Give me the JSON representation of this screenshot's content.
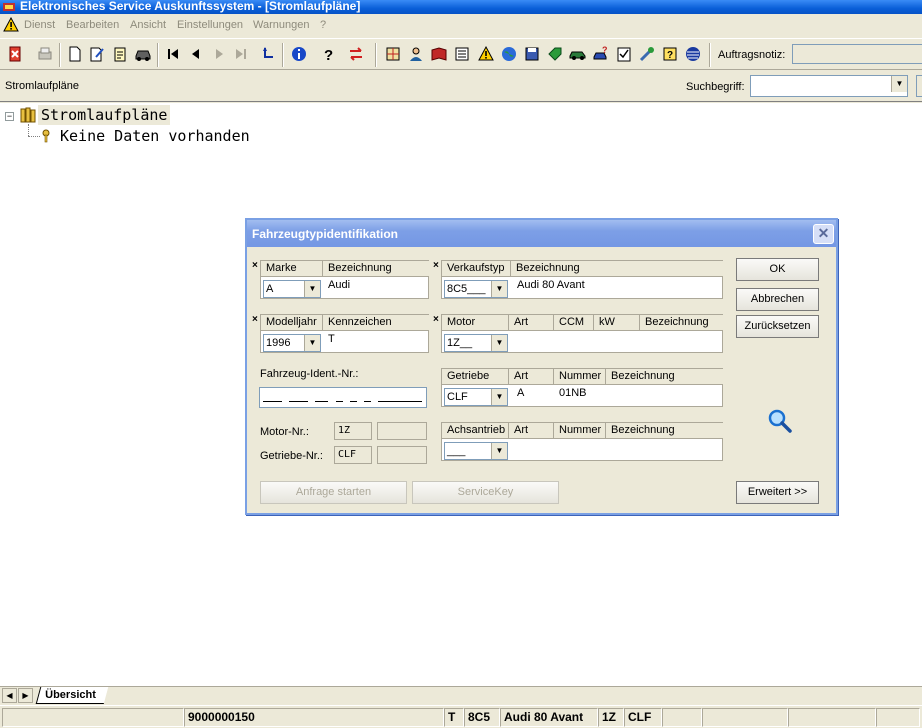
{
  "window": {
    "title": "Elektronisches Service Auskunftssystem - [Stromlaufpläne]"
  },
  "menu": [
    "Dienst",
    "Bearbeiten",
    "Ansicht",
    "Einstellungen",
    "Warnungen",
    "?"
  ],
  "toolbar": {
    "note_label": "Auftragsnotiz:",
    "note_value": "",
    "icons": [
      "exit-icon",
      "print-icon",
      "new-document-icon",
      "edit-document-icon",
      "notes-icon",
      "car-icon",
      "first-icon",
      "previous-icon",
      "next-icon",
      "last-icon",
      "return-icon",
      "info-icon",
      "help-icon",
      "switch-icon",
      "wiring-icon",
      "person-icon",
      "book-icon",
      "list-icon",
      "warning-icon",
      "globe-icon",
      "save-icon",
      "tag-icon",
      "vehicle-icon",
      "service-icon",
      "checklist-icon",
      "tools-icon",
      "question-icon",
      "stack-icon"
    ]
  },
  "bar": {
    "title": "Stromlaufpläne",
    "search_label": "Suchbegriff:",
    "search_value": ""
  },
  "tree": {
    "root_label": "Stromlaufpläne",
    "child_label": "Keine Daten vorhanden"
  },
  "dialog": {
    "title": "Fahrzeugtypidentifikation",
    "required_mark": "×",
    "marke": {
      "headers": [
        "Marke",
        "Bezeichnung"
      ],
      "value": "A",
      "description": "Audi"
    },
    "verkaufstyp": {
      "headers": [
        "Verkaufstyp",
        "Bezeichnung"
      ],
      "value": "8C5___",
      "description": "Audi 80 Avant"
    },
    "modelljahr": {
      "headers": [
        "Modelljahr",
        "Kennzeichen"
      ],
      "value": "1996",
      "description": "T"
    },
    "motor": {
      "headers": [
        "Motor",
        "Art",
        "CCM",
        "kW",
        "Bezeichnung"
      ],
      "value": "1Z__",
      "art": "",
      "ccm": "",
      "kw": "",
      "description": ""
    },
    "fin_label": "Fahrzeug-Ident.-Nr.:",
    "getriebe": {
      "headers": [
        "Getriebe",
        "Art",
        "Nummer",
        "Bezeichnung"
      ],
      "value": "CLF",
      "art": "A",
      "nummer": "01NB",
      "description": ""
    },
    "motor_nr_label": "Motor-Nr.:",
    "motor_nr_value": "1Z",
    "getriebe_nr_label": "Getriebe-Nr.:",
    "getriebe_nr_value": "CLF",
    "achsantrieb": {
      "headers": [
        "Achsantrieb",
        "Art",
        "Nummer",
        "Bezeichnung"
      ],
      "value": "___",
      "art": "",
      "nummer": "",
      "description": ""
    },
    "buttons": {
      "ok": "OK",
      "cancel": "Abbrechen",
      "reset": "Zurücksetzen",
      "extended": "Erweitert >>",
      "request": "Anfrage starten",
      "servicekey": "ServiceKey"
    }
  },
  "tabs": {
    "active": "Übersicht"
  },
  "status": {
    "order_number": "9000000150",
    "kennzeichen": "T",
    "verkaufstyp": "8C5",
    "model": "Audi 80 Avant",
    "motor": "1Z",
    "getriebe": "CLF"
  },
  "colors": {
    "titlebar": "#0a5fd8",
    "dialog_titlebar": "#7d9fe6",
    "face": "#ece9d8"
  }
}
